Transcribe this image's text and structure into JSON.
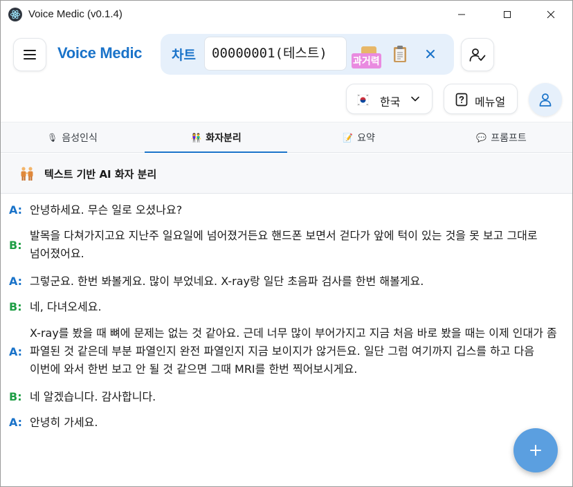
{
  "window": {
    "title": "Voice Medic (v0.1.4)"
  },
  "header": {
    "brand": "Voice Medic",
    "chart_label": "차트",
    "chart_value": "00000001(테스트)",
    "history_label": "과거력"
  },
  "toolbar": {
    "language": "한국",
    "manual_label": "메뉴얼"
  },
  "tabs": [
    {
      "icon": "🎙",
      "label": "음성인식"
    },
    {
      "icon": "👫",
      "label": "화자분리"
    },
    {
      "icon": "📝",
      "label": "요약"
    },
    {
      "icon": "💬",
      "label": "프롬프트"
    }
  ],
  "active_tab": 1,
  "section": {
    "icon": "👫",
    "title": "텍스트 기반 AI 화자 분리"
  },
  "transcript": [
    {
      "speaker": "A:",
      "text": "안녕하세요. 무슨 일로 오셨나요?"
    },
    {
      "speaker": "B:",
      "text": "발목을 다쳐가지고요 지난주 일요일에 넘어졌거든요 핸드폰 보면서 걷다가 앞에 턱이 있는 것을 못 보고 그대로 넘어졌어요."
    },
    {
      "speaker": "A:",
      "text": "그렇군요. 한번 봐볼게요. 많이 부었네요. X-ray랑 일단 초음파 검사를 한번 해볼게요."
    },
    {
      "speaker": "B:",
      "text": "네, 다녀오세요."
    },
    {
      "speaker": "A:",
      "text": "X-ray를 봤을 때 뼈에 문제는 없는 것 같아요. 근데 너무 많이 부어가지고 지금 처음 바로 봤을 때는 이제 인대가 좀 파열된 것 같은데 부분 파열인지 완전 파열인지 지금 보이지가 않거든요. 일단 그럼 여기까지 깁스를 하고 다음 이번에 와서 한번 보고 안 될 것 같으면 그때 MRI를 한번 찍어보시게요."
    },
    {
      "speaker": "B:",
      "text": "네 알겠습니다. 감사합니다."
    },
    {
      "speaker": "A:",
      "text": "안녕히 가세요."
    }
  ],
  "colors": {
    "brand": "#1a73c9",
    "speaker_a": "#1a73c9",
    "speaker_b": "#1e9e45",
    "fab": "#5b9fe0"
  }
}
